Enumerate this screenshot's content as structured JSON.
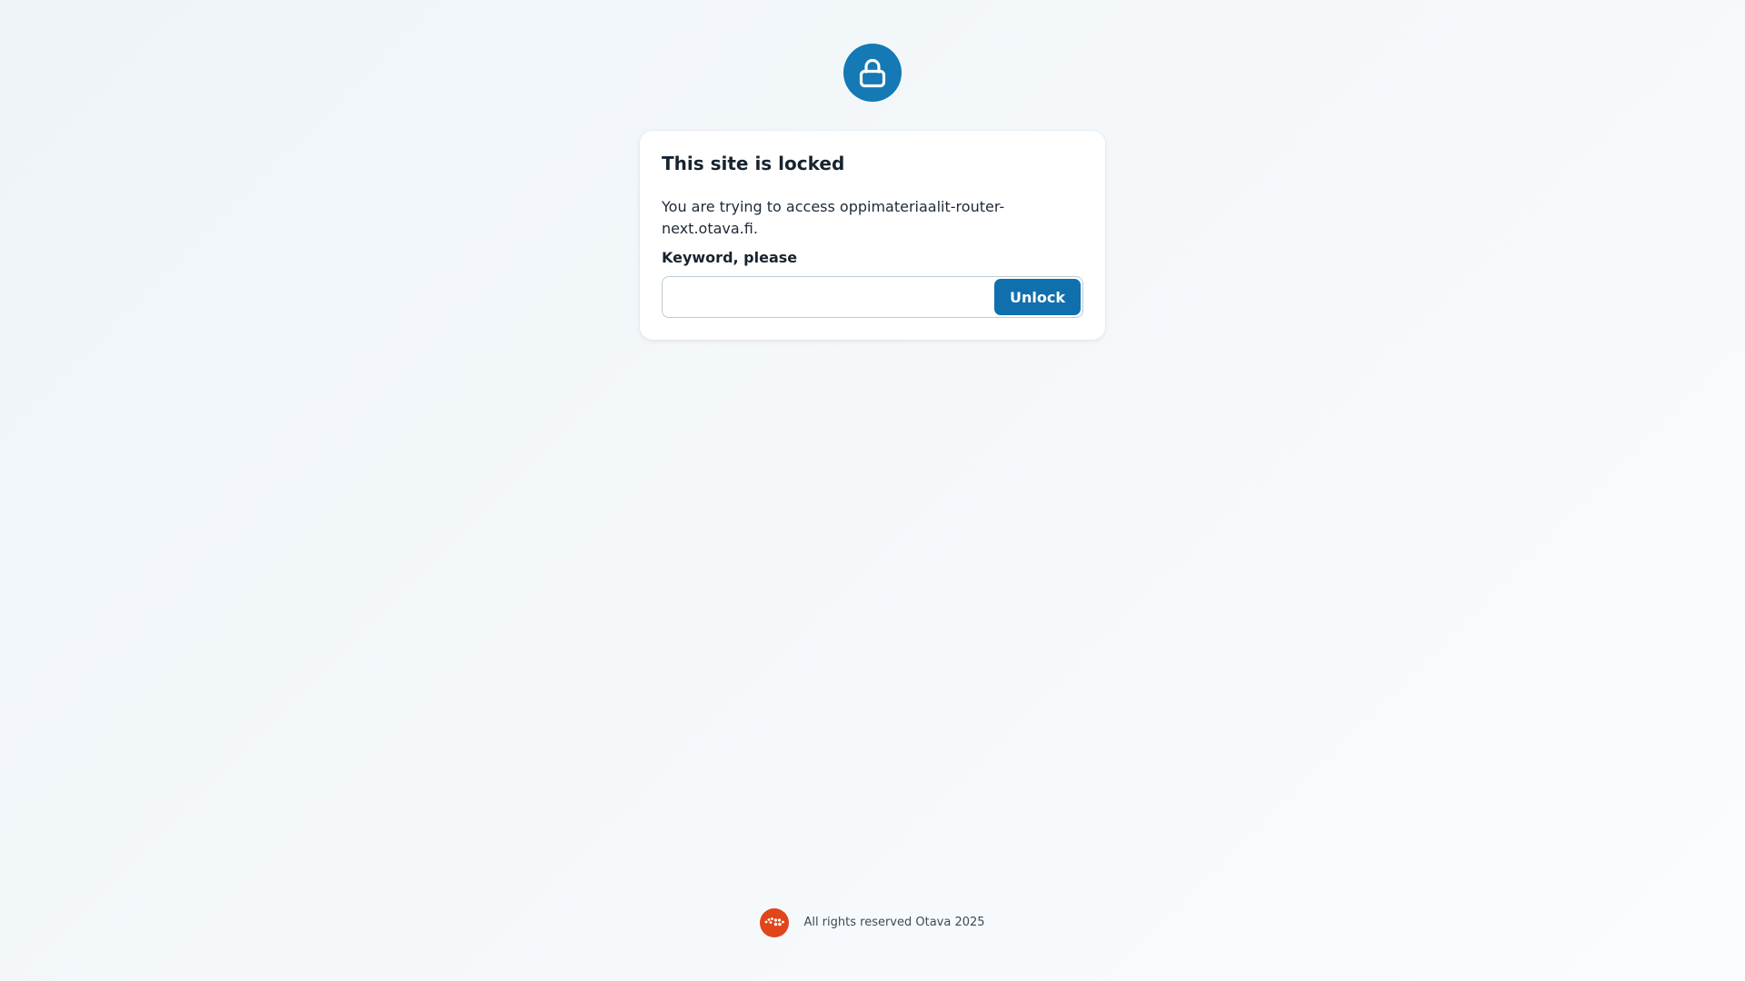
{
  "lock": {
    "icon": "lock-icon",
    "color": "#1479b4"
  },
  "card": {
    "title": "This site is locked",
    "message": "You are trying to access oppimateriaalit-router-next.otava.fi.",
    "keyword_label": "Keyword, please",
    "keyword_value": "",
    "keyword_placeholder": "",
    "unlock_label": "Unlock",
    "accent_color": "#1070ad"
  },
  "footer": {
    "logo_icon": "otava-logo-icon",
    "logo_color": "#e1451a",
    "text": "All rights reserved Otava 2025"
  }
}
